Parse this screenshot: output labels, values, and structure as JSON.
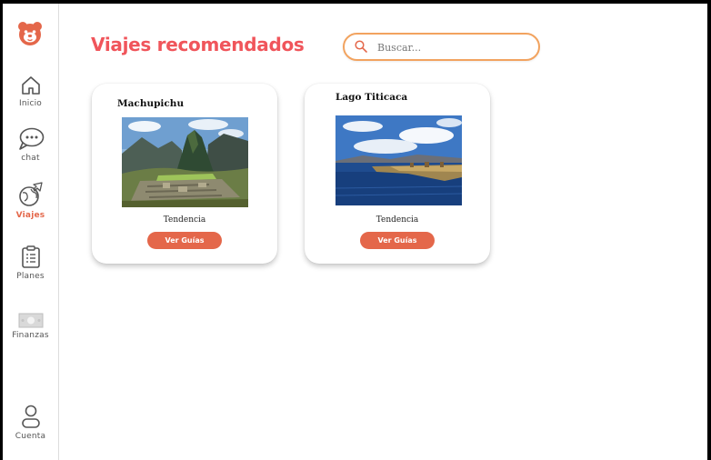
{
  "sidebar": {
    "logo_icon": "bear-logo-icon",
    "items": [
      {
        "label": "Inicio",
        "icon": "home-icon"
      },
      {
        "label": "chat",
        "icon": "chat-icon"
      },
      {
        "label": "Viajes",
        "icon": "globe-plane-icon",
        "active": true
      },
      {
        "label": "Planes",
        "icon": "clipboard-icon"
      },
      {
        "label": "Finanzas",
        "icon": "money-icon"
      },
      {
        "label": "Cuenta",
        "icon": "user-icon"
      }
    ]
  },
  "header": {
    "title": "Viajes recomendados",
    "search_placeholder": "Buscar..."
  },
  "cards": [
    {
      "title": "Machupichu",
      "tag": "Tendencia",
      "button_label": "Ver Guías"
    },
    {
      "title": "Lago Titicaca",
      "tag": "Tendencia",
      "button_label": "Ver Guías"
    }
  ],
  "colors": {
    "accent": "#e4674a",
    "title": "#f0555b",
    "search_border": "#f2a35f"
  }
}
